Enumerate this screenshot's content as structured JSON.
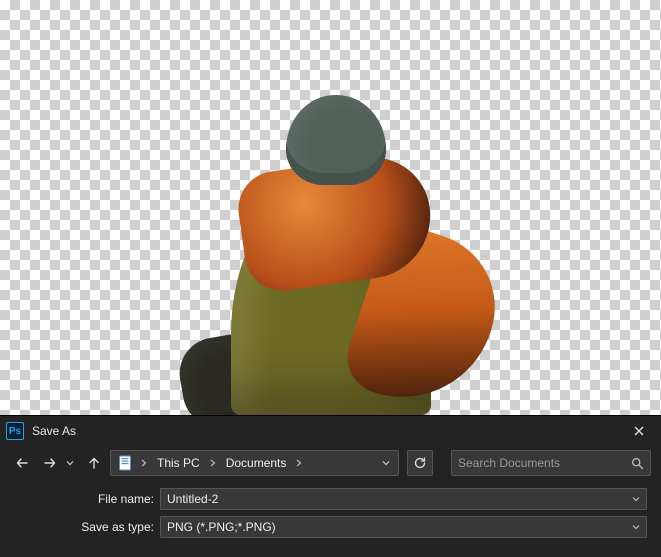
{
  "app_icon_text": "Ps",
  "dialog": {
    "title": "Save As"
  },
  "breadcrumb": {
    "segments": [
      "This PC",
      "Documents"
    ]
  },
  "search": {
    "placeholder": "Search Documents"
  },
  "fields": {
    "filename_label": "File name:",
    "filename_value": "Untitled-2",
    "savetype_label": "Save as type:",
    "savetype_value": "PNG (*.PNG;*.PNG)"
  }
}
